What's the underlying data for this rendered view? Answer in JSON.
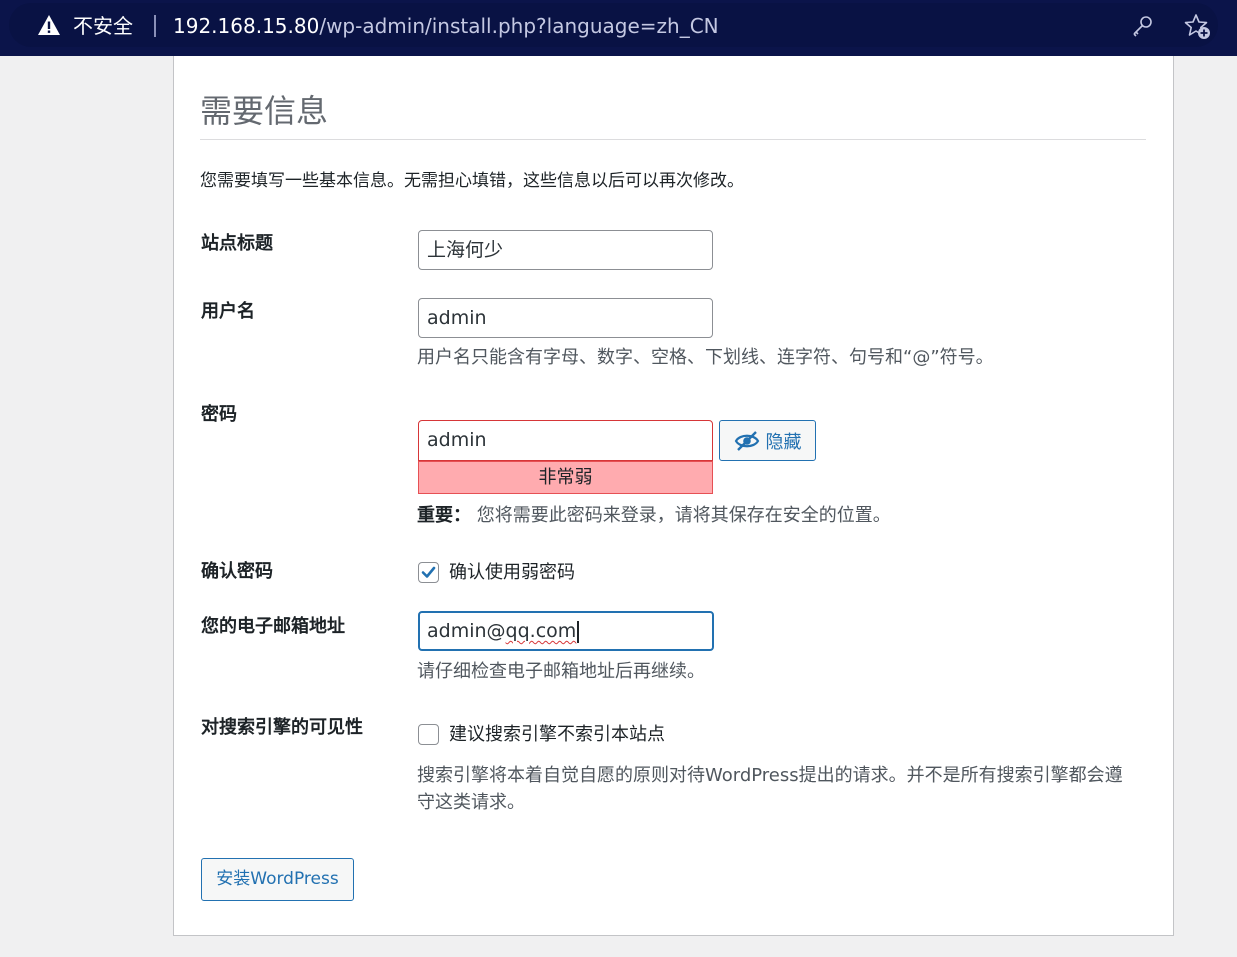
{
  "browser": {
    "security_label": "不安全",
    "url_host": "192.168.15.80",
    "url_path": "/wp-admin/install.php?language=zh_CN"
  },
  "page": {
    "title": "需要信息",
    "intro": "您需要填写一些基本信息。无需担心填错，这些信息以后可以再次修改。"
  },
  "form": {
    "site_title": {
      "label": "站点标题",
      "value": "上海何少"
    },
    "username": {
      "label": "用户名",
      "value": "admin",
      "hint": "用户名只能含有字母、数字、空格、下划线、连字符、句号和“@”符号。"
    },
    "password": {
      "label": "密码",
      "value": "admin",
      "strength": "非常弱",
      "hide_label": "隐藏",
      "important_label": "重要：",
      "important_text": "您将需要此密码来登录，请将其保存在安全的位置。"
    },
    "confirm": {
      "label": "确认密码",
      "checkbox_label": "确认使用弱密码",
      "checked": true
    },
    "email": {
      "label": "您的电子邮箱地址",
      "value_prefix": "admin@",
      "value_misspelled": "qq.com",
      "hint": "请仔细检查电子邮箱地址后再继续。"
    },
    "visibility": {
      "label": "对搜索引擎的可见性",
      "checkbox_label": "建议搜索引擎不索引本站点",
      "checked": false,
      "description": "搜索引擎将本着自觉自愿的原则对待WordPress提出的请求。并不是所有搜索引擎都会遵守这类请求。"
    },
    "submit_label": "安装WordPress"
  },
  "colors": {
    "accent": "#2271b1",
    "weak_password_bg": "#ffabaf",
    "weak_password_border": "#d63638",
    "browser_bar": "#0b144a"
  },
  "icons": [
    "warning-icon",
    "key-icon",
    "add-favorite-icon",
    "eye-slash-icon",
    "checkmark-icon"
  ]
}
